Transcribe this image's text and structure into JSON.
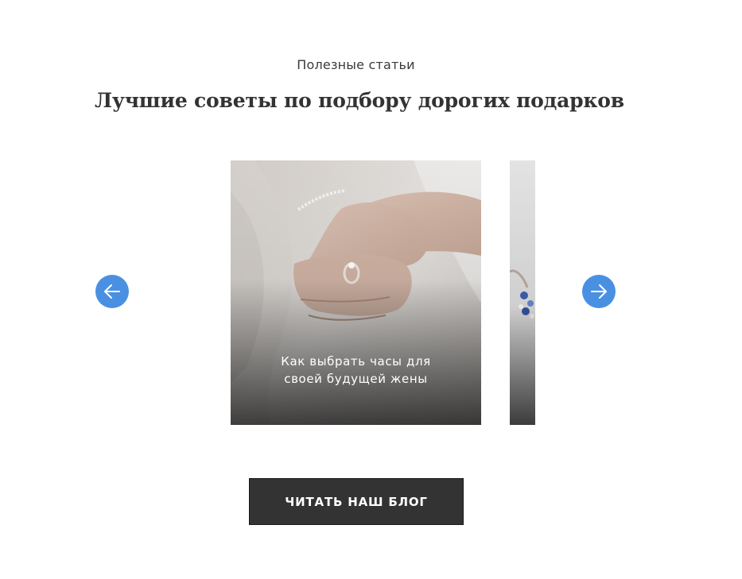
{
  "section": {
    "eyebrow": "Полезные статьи",
    "heading": "Лучшие советы по подбору дорогих подарков"
  },
  "carousel": {
    "prev_icon": "arrow-left-icon",
    "next_icon": "arrow-right-icon",
    "accent_color": "#4a90e2",
    "cards": [
      {
        "caption": "Как выбрать часы для своей будущей жены",
        "image": "hands-with-wedding-ring"
      },
      {
        "caption": "",
        "image": "jewelry-earrings"
      }
    ]
  },
  "blog_button": {
    "label": "ЧИТАТЬ НАШ БЛОГ",
    "color": "#333333"
  }
}
